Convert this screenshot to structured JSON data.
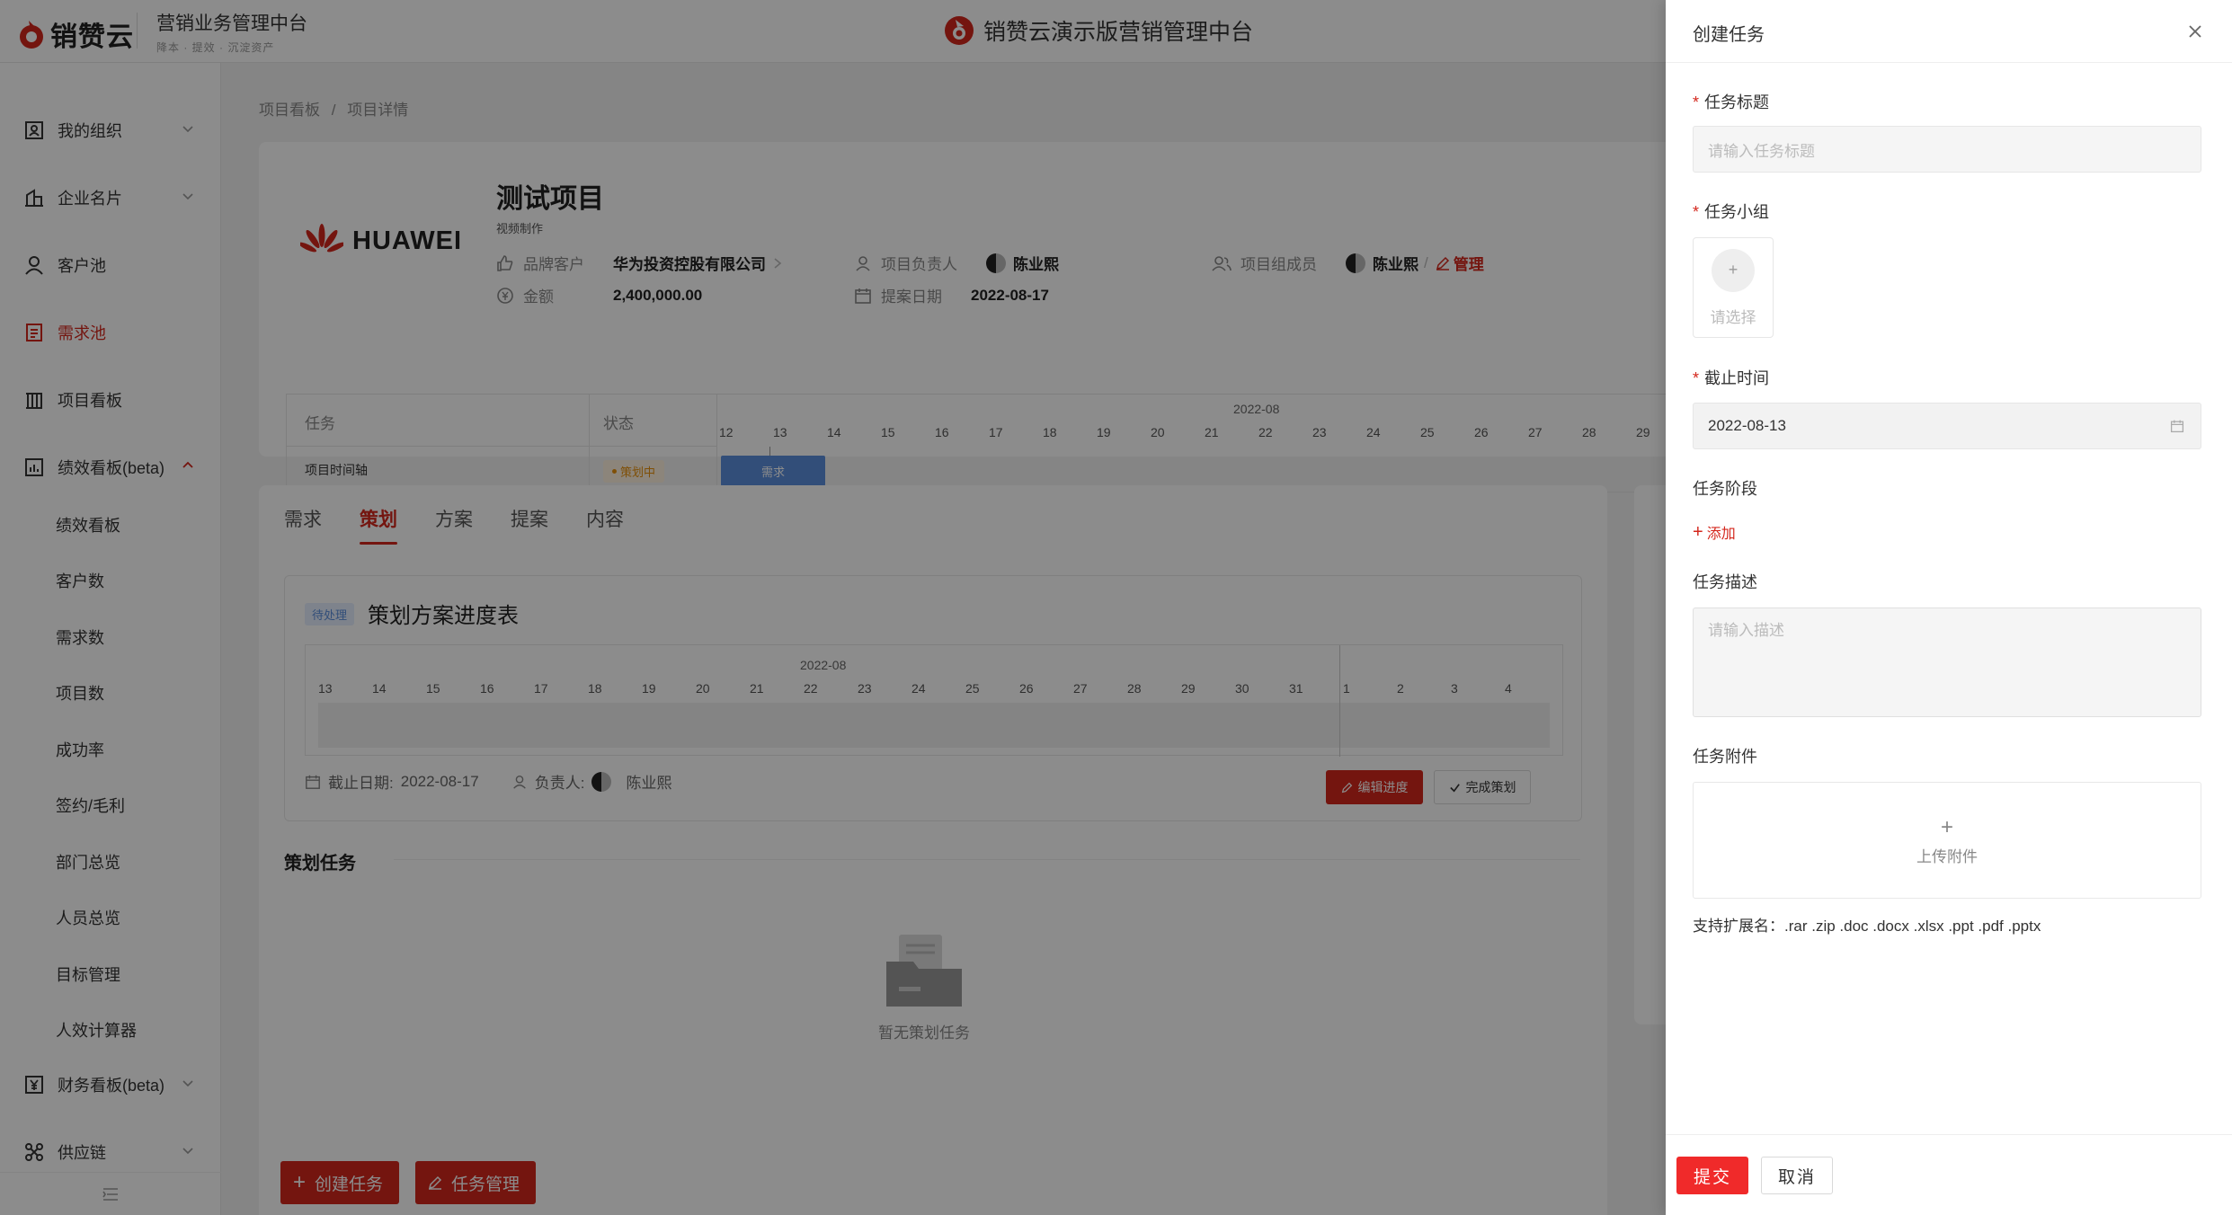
{
  "header": {
    "logo_text": "销赞云",
    "subtitle": "营销业务管理中台",
    "subtitle_tags": "降本 · 提效 · 沉淀资产",
    "center_title": "销赞云演示版营销管理中台"
  },
  "sidebar": {
    "items": [
      {
        "label": "我的组织",
        "icon": "org-icon"
      },
      {
        "label": "企业名片",
        "icon": "building-icon"
      },
      {
        "label": "客户池",
        "icon": "user-icon"
      },
      {
        "label": "需求池",
        "icon": "doc-icon"
      },
      {
        "label": "项目看板",
        "icon": "board-icon"
      },
      {
        "label": "绩效看板(beta)",
        "icon": "chart-icon"
      },
      {
        "label": "财务看板(beta)",
        "icon": "yen-icon"
      },
      {
        "label": "供应链",
        "icon": "network-icon"
      }
    ],
    "sub_items": [
      "绩效看板",
      "客户数",
      "需求数",
      "项目数",
      "成功率",
      "签约/毛利",
      "部门总览",
      "人员总览",
      "目标管理",
      "人效计算器"
    ],
    "footer_icon": "collapse-icon"
  },
  "breadcrumb": {
    "level1": "项目看板",
    "sep": "/",
    "level2": "项目详情"
  },
  "project": {
    "logo_text": "HUAWEI",
    "title": "测试项目",
    "tag": "视频制作",
    "brand_label": "品牌客户",
    "brand_value": "华为投资控股有限公司",
    "amount_label": "金额",
    "amount_value": "2,400,000.00",
    "owner_label": "项目负责人",
    "owner_value": "陈业熙",
    "date_label": "提案日期",
    "date_value": "2022-08-17",
    "members_label": "项目组成员",
    "members_value": "陈业熙",
    "members_sep": "/",
    "manage_label": "管理"
  },
  "gantt": {
    "col_task": "任务",
    "col_status": "状态",
    "row_task": "项目时间轴",
    "row_status": "策划中",
    "month": "2022-08",
    "days": [
      "12",
      "13",
      "14",
      "15",
      "16",
      "17",
      "18",
      "19",
      "20",
      "21",
      "22",
      "23",
      "24",
      "25",
      "26",
      "27",
      "28",
      "29"
    ],
    "bar_label": "需求"
  },
  "tabs": [
    "需求",
    "策划",
    "方案",
    "提案",
    "内容"
  ],
  "active_tab": "策划",
  "plan": {
    "badge": "待处理",
    "title": "策划方案进度表",
    "month": "2022-08",
    "days": [
      "13",
      "14",
      "15",
      "16",
      "17",
      "18",
      "19",
      "20",
      "21",
      "22",
      "23",
      "24",
      "25",
      "26",
      "27",
      "28",
      "29",
      "30",
      "31",
      "1",
      "2",
      "3",
      "4"
    ],
    "deadline_label": "截止日期:",
    "deadline_value": "2022-08-17",
    "owner_label": "负责人:",
    "owner_value": "陈业熙",
    "edit_button": "编辑进度",
    "done_button": "完成策划"
  },
  "tasks": {
    "section_title": "策划任务",
    "empty_text": "暂无策划任务",
    "create_button": "创建任务",
    "manage_button": "任务管理"
  },
  "drawer": {
    "title": "创建任务",
    "title_label": "任务标题",
    "title_placeholder": "请输入任务标题",
    "group_label": "任务小组",
    "group_placeholder": "请选择",
    "deadline_label": "截止时间",
    "deadline_value": "2022-08-13",
    "stage_label": "任务阶段",
    "add_label": "添加",
    "desc_label": "任务描述",
    "desc_placeholder": "请输入描述",
    "attach_label": "任务附件",
    "upload_label": "上传附件",
    "ext_note": "支持扩展名：.rar .zip .doc .docx .xlsx .ppt .pdf .pptx",
    "submit": "提交",
    "cancel": "取消"
  },
  "colors": {
    "accent": "#d4271d",
    "bar": "#5b8fdc",
    "mask": "rgba(0,0,0,0.45)"
  }
}
